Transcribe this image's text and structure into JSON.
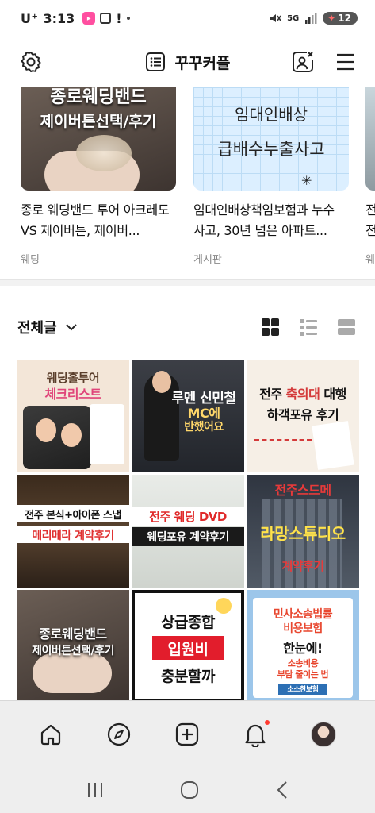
{
  "status_bar": {
    "carrier": "U⁺",
    "time": "3:13",
    "network": "5G",
    "battery": "12"
  },
  "header": {
    "title": "꾸꾸커플"
  },
  "top_cards": [
    {
      "thumb_line1": "종로웨딩밴드",
      "thumb_line2": "제이버튼선택/후기",
      "title": "종로 웨딩밴드 투어 아크레도 VS 제이버튼, 제이버...",
      "category": "웨딩"
    },
    {
      "thumb_line1": "임대인배상",
      "thumb_line2": "급배수누출사고",
      "title": "임대인배상책임보험과 누수 사고, 30년 넘은 아파트...",
      "category": "게시판"
    },
    {
      "title": "전\n전",
      "category": "웨"
    }
  ],
  "filter": {
    "label": "전체글"
  },
  "grid_tiles": [
    {
      "line1": "웨딩홀투어",
      "line2": "체크리스트"
    },
    {
      "line1": "루멘 신민철",
      "line2": "MC에",
      "line3": "반했어요"
    },
    {
      "line1_pre": "전주 ",
      "line1_hl": "축의대",
      "line1_post": " 대행",
      "line2": "하객포유 후기"
    },
    {
      "line1": "전주 본식+아이폰 스냅",
      "line2": "메리메라 계약후기"
    },
    {
      "line1": "전주 웨딩 DVD",
      "line2": "웨딩포유 계약후기"
    },
    {
      "line1": "전주스드메",
      "line2": "라망스튜디오",
      "line3": "계약후기"
    },
    {
      "line1": "종로웨딩밴드",
      "line2": "제이버튼선택/후기"
    },
    {
      "line1": "상급종합",
      "line2": "입원비",
      "line3": "충분할까"
    },
    {
      "line1": "민사소송법률",
      "line2": "비용보험",
      "line3": "한눈에!",
      "line4": "소송비용",
      "line5": "부담 줄이는 법",
      "line6": "소소한보험"
    }
  ],
  "colors": {
    "accent_red": "#e21d2c",
    "notification_dot": "#ff3b30"
  },
  "icons": {
    "settings": "gear-icon",
    "list": "list-icon",
    "profile_edit": "profile-edit-icon",
    "menu": "hamburger-icon",
    "home": "home-icon",
    "explore": "compass-icon",
    "create": "plus-square-icon",
    "notifications": "bell-icon"
  }
}
